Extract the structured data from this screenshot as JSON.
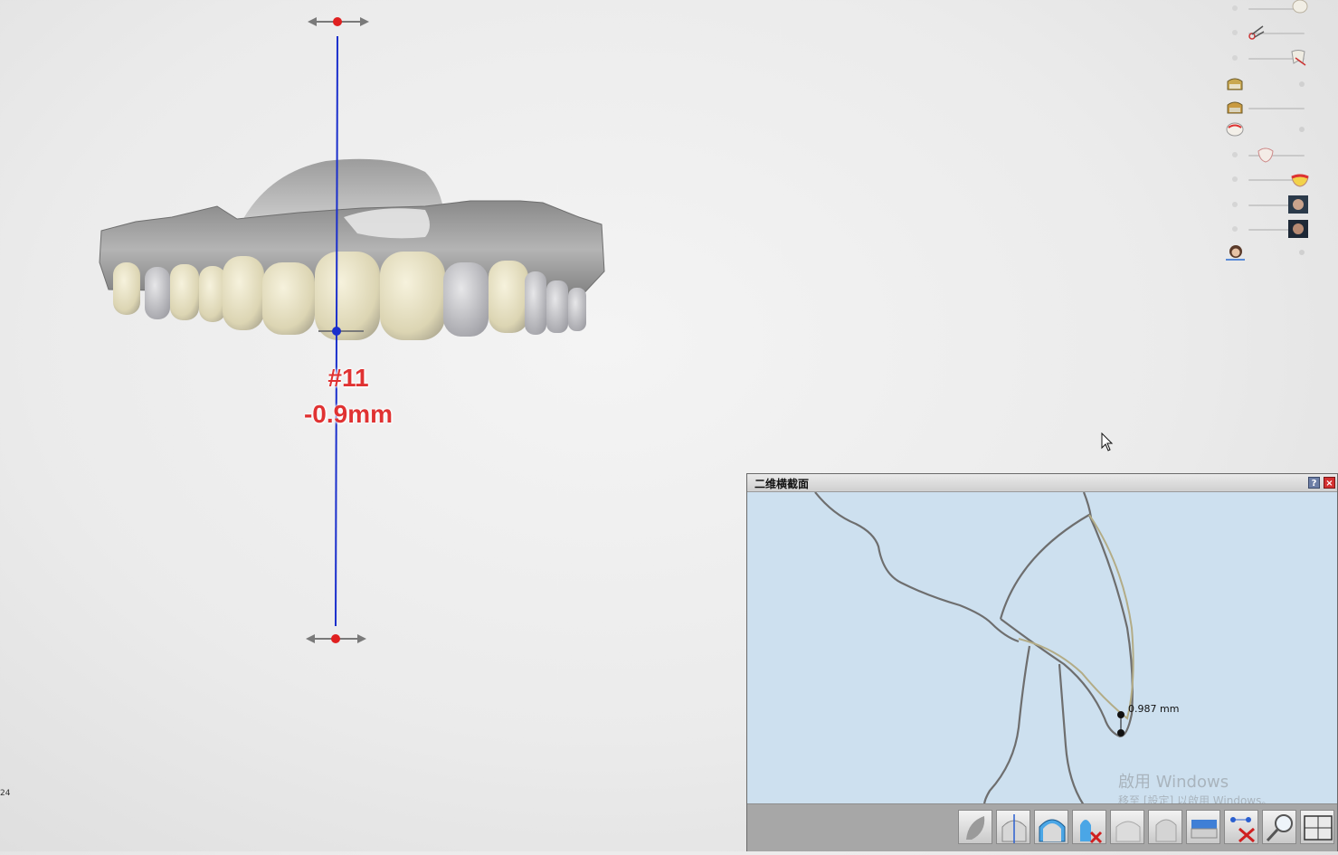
{
  "annotation": {
    "tooth_number": "#11",
    "offset": "-0.9mm",
    "corner_number": "24"
  },
  "layers": [
    {
      "icon": "tooth-icon"
    },
    {
      "icon": "scissors-icon"
    },
    {
      "icon": "cut-tooth-icon"
    },
    {
      "icon": "crown-model-icon"
    },
    {
      "icon": "crown-model-2-icon"
    },
    {
      "icon": "gum-arch-icon"
    },
    {
      "icon": "tooth-shell-icon"
    },
    {
      "icon": "gum-tooth-icon"
    },
    {
      "icon": "face-photo-icon"
    },
    {
      "icon": "face-photo-2-icon"
    },
    {
      "icon": "avatar-icon"
    }
  ],
  "cross_section": {
    "title": "二维横截面",
    "help": "?",
    "close": "×",
    "measurement": "0.987 mm",
    "watermark_line1": "啟用 Windows",
    "watermark_line2": "移至 [設定] 以啟用 Windows。",
    "tools": [
      "section-shape-tool",
      "split-tooth-tool",
      "tooth-outline-tool",
      "delete-tooth-tool",
      "tooth-view-tool",
      "tooth-view-2-tool",
      "text-label-tool",
      "delete-measure-tool",
      "magnifier-tool",
      "grid-tool"
    ]
  },
  "colors": {
    "axis": "#1a2fcc",
    "handle": "#e02020",
    "label": "#e03232",
    "section_bg": "#cde0ef",
    "contour": "#6e6e6e",
    "contour_alt": "#b3ac86"
  }
}
